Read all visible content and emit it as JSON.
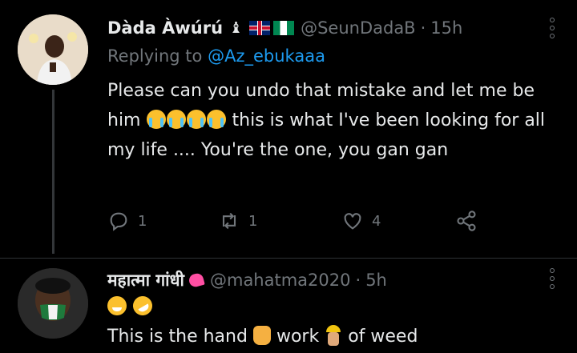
{
  "tweets": [
    {
      "name": "Dàda Àwúrú",
      "badge": "♝",
      "flags": [
        "uk-flag",
        "nigeria-flag"
      ],
      "handle": "@SeunDadaB",
      "time": "15h",
      "replying_label": "Replying to",
      "replying_handle": "@Az_ebukaaa",
      "text_a": "Please can you undo that mistake and let me be him",
      "text_b": "this is what I've been looking for all my life .... You're the one, you gan gan",
      "emojis": [
        "loudly-crying-face",
        "loudly-crying-face",
        "loudly-crying-face",
        "loudly-crying-face"
      ],
      "actions": {
        "replies": "1",
        "retweets": "1",
        "likes": "4"
      }
    },
    {
      "name": "महात्मा गांधी",
      "handle": "@mahatma2020",
      "time": "5h",
      "line1_emojis": [
        "grinning-face",
        "rolling-on-floor-laughing"
      ],
      "text_a": "This is the hand",
      "text_b": "work",
      "text_c": "of weed"
    }
  ],
  "separator": "·",
  "colors": {
    "background": "#000000",
    "text": "#e7e9ea",
    "muted": "#71767b",
    "link": "#1d9bf0",
    "divider": "#2f3336"
  }
}
